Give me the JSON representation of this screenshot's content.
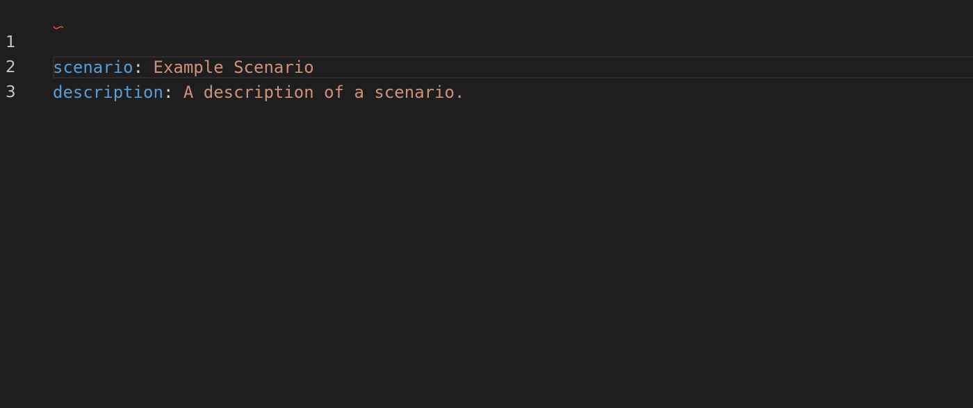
{
  "editor": {
    "lines": [
      {
        "number": "1",
        "key": "scenario",
        "colon": ":",
        "value": " Example Scenario"
      },
      {
        "number": "2",
        "key": "description",
        "colon": ":",
        "value": " A description of a scenario."
      },
      {
        "number": "3",
        "key": "",
        "colon": "",
        "value": ""
      }
    ]
  },
  "colors": {
    "background": "#1e1e1e",
    "key": "#569cd6",
    "value": "#ce9178",
    "line_number": "#c6c6c6",
    "current_line_border": "#2c2c2c",
    "squiggle": "#f14c4c"
  }
}
